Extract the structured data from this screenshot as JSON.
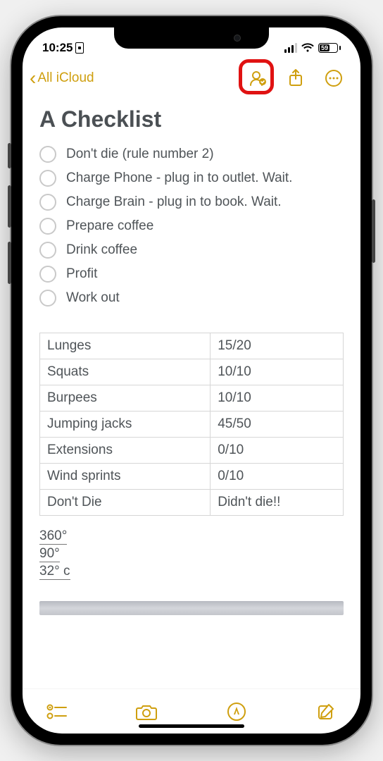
{
  "status": {
    "time": "10:25",
    "battery_pct": "59"
  },
  "nav": {
    "back_label": "All iCloud"
  },
  "note": {
    "title": "A Checklist",
    "checklist": [
      "Don't die (rule number 2)",
      "Charge Phone - plug in to outlet. Wait.",
      "Charge Brain - plug in to book. Wait.",
      "Prepare coffee",
      "Drink coffee",
      "Profit",
      "Work out"
    ],
    "table": [
      {
        "name": "Lunges",
        "val": "15/20"
      },
      {
        "name": "Squats",
        "val": "10/10"
      },
      {
        "name": "Burpees",
        "val": "10/10"
      },
      {
        "name": "Jumping jacks",
        "val": "45/50"
      },
      {
        "name": "Extensions",
        "val": "0/10"
      },
      {
        "name": "Wind sprints",
        "val": "0/10"
      },
      {
        "name": "Don't Die",
        "val": "Didn't die!!"
      }
    ],
    "temps": [
      "360°",
      "90°",
      "32° c"
    ]
  }
}
